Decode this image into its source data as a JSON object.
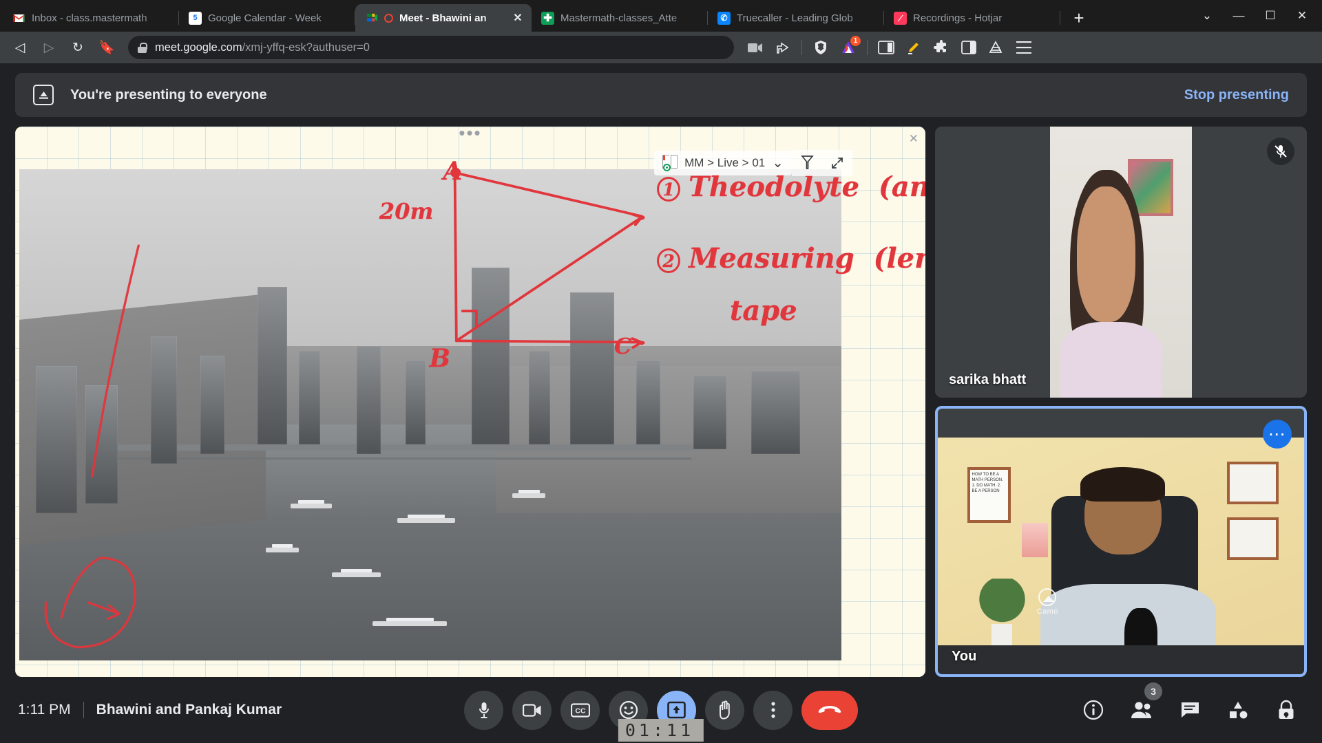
{
  "browser": {
    "tabs": [
      {
        "title": "Inbox - class.mastermath",
        "favicon": "gmail-icon",
        "active": false
      },
      {
        "title": "Google Calendar - Week",
        "favicon": "google-calendar-icon",
        "active": false
      },
      {
        "title": "Meet - Bhawini an",
        "favicon": "google-meet-icon",
        "active": true,
        "recording": true
      },
      {
        "title": "Mastermath-classes_Atte",
        "favicon": "google-classroom-icon",
        "active": false
      },
      {
        "title": "Truecaller - Leading Glob",
        "favicon": "truecaller-icon",
        "active": false
      },
      {
        "title": "Recordings - Hotjar",
        "favicon": "hotjar-icon",
        "active": false
      }
    ],
    "new_tab_label": "+",
    "window_controls": {
      "tab_search": "⌄",
      "minimize": "—",
      "maximize": "☐",
      "close": "✕"
    },
    "address": {
      "domain": "meet.google.com",
      "path": "/xmj-yffq-esk?authuser=0",
      "full_url": "meet.google.com/xmj-yffq-esk?authuser=0",
      "secure": true
    },
    "toolbar_icons": [
      "screen-record-icon",
      "share-icon",
      "brave-shields-icon",
      "brave-rewards-icon",
      "sidebar-icon",
      "highlighter-icon",
      "extensions-icon",
      "split-view-icon",
      "brave-leo-icon",
      "menu-icon"
    ],
    "rewards_badge": "1"
  },
  "meet": {
    "present_banner": {
      "icon": "present-screen-icon",
      "text": "You're presenting to everyone",
      "action_label": "Stop presenting",
      "action_color": "#8ab4f8"
    },
    "shared_screen": {
      "dots_handle": "•••",
      "close_label": "✕",
      "whiteboard_header": {
        "breadcrumb": "MM > Live > 01",
        "chevron": "⌄",
        "tool_icon": "highlighter-icon",
        "expand_icon": "expand-icon"
      },
      "annotations": {
        "vertex_a": "A",
        "vertex_b": "B",
        "vertex_c": "C",
        "side_label": "20m",
        "item_1_number": "1",
        "item_1_text": "Theodolyte",
        "item_1_paren": "(angle)",
        "item_2_number": "2",
        "item_2_text": "Measuring",
        "item_2_paren": "(length)",
        "item_2_text_line2": "tape"
      }
    },
    "participants": [
      {
        "name": "sarika bhatt",
        "muted": true,
        "mute_icon": "mic-off-icon",
        "self": false
      },
      {
        "name": "You",
        "muted": false,
        "more_icon": "more-options-icon",
        "self": true,
        "watermark": "Camo",
        "poster_text": "HOW TO BE A MATH PERSON. 1. DO MATH. 2. BE A PERSON"
      }
    ],
    "footer": {
      "time": "1:11 PM",
      "meeting_name": "Bhawini and Pankaj Kumar"
    },
    "controls": [
      {
        "name": "microphone-button",
        "icon": "mic-icon",
        "active": false
      },
      {
        "name": "camera-button",
        "icon": "camera-icon",
        "active": false
      },
      {
        "name": "captions-button",
        "icon": "cc-icon",
        "active": false
      },
      {
        "name": "reactions-button",
        "icon": "emoji-icon",
        "active": false
      },
      {
        "name": "present-button",
        "icon": "present-icon",
        "active": true
      },
      {
        "name": "raise-hand-button",
        "icon": "hand-icon",
        "active": false
      },
      {
        "name": "more-options-button",
        "icon": "kebab-icon",
        "active": false
      },
      {
        "name": "leave-call-button",
        "icon": "end-call-icon",
        "active": false
      }
    ],
    "right_controls": [
      {
        "name": "meeting-details-button",
        "icon": "info-icon",
        "badge": ""
      },
      {
        "name": "people-button",
        "icon": "people-icon",
        "badge": "3"
      },
      {
        "name": "chat-button",
        "icon": "chat-icon",
        "badge": ""
      },
      {
        "name": "activities-button",
        "icon": "activities-icon",
        "badge": ""
      },
      {
        "name": "host-controls-button",
        "icon": "lock-icon",
        "badge": ""
      }
    ],
    "recording_timer": "01:11"
  }
}
